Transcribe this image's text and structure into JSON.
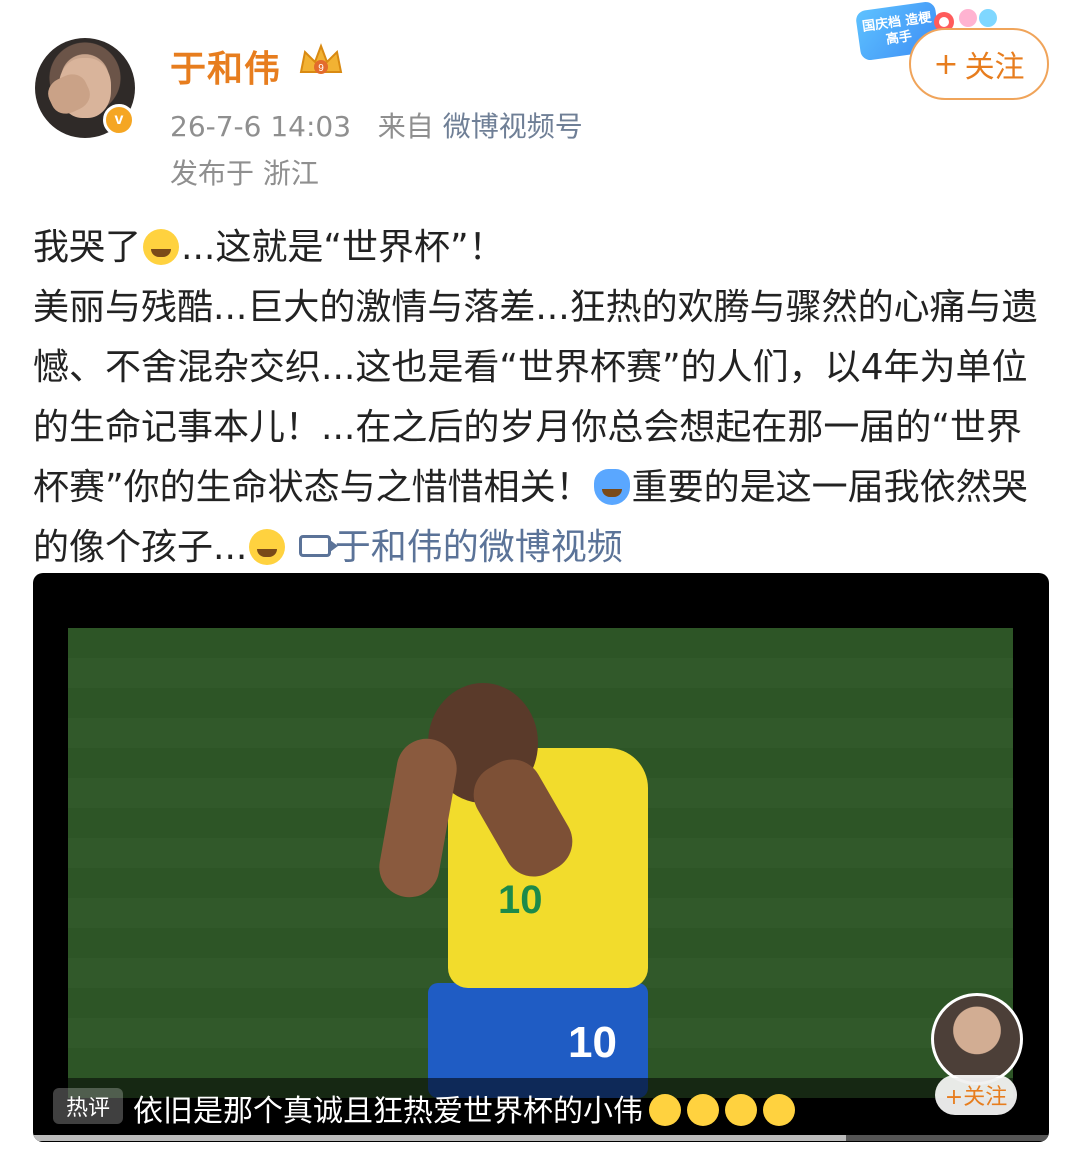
{
  "post": {
    "username": "于和伟",
    "timestamp": "26-7-6 14:03",
    "source_prefix": "来自",
    "source_link": "微博视频号",
    "location": "发布于 浙江",
    "follow_label": "关注",
    "follow_icon": "plus-icon",
    "verified_badge": "v",
    "promo_text": "国庆档 造梗高手"
  },
  "content": {
    "line1_a": "我哭了",
    "line1_b": "...这就是“世界杯”！",
    "body": "美丽与残酷...巨大的激情与落差...狂热的欢腾与骤然的心痛与遗憾、不舍混杂交织...这也是看“世界杯赛”的人们，以4年为单位的生命记事本儿！...在之后的岁月你总会想起在那一届的“世界杯赛”你的生命状态与之惜惜相关！",
    "tail_a": "重要的是这一届我依然哭的像个孩子...",
    "video_link": "于和伟的微博视频"
  },
  "video": {
    "shirt_number": "10",
    "shorts_number": "10",
    "hot_tag": "热评",
    "hot_comment": "依旧是那个真诚且狂热爱世界杯的小伟",
    "mini_follow": "+关注",
    "progress": 0.8
  },
  "colors": {
    "accent": "#e77d1e",
    "link": "#5b7398",
    "meta": "#8f8f8f"
  }
}
